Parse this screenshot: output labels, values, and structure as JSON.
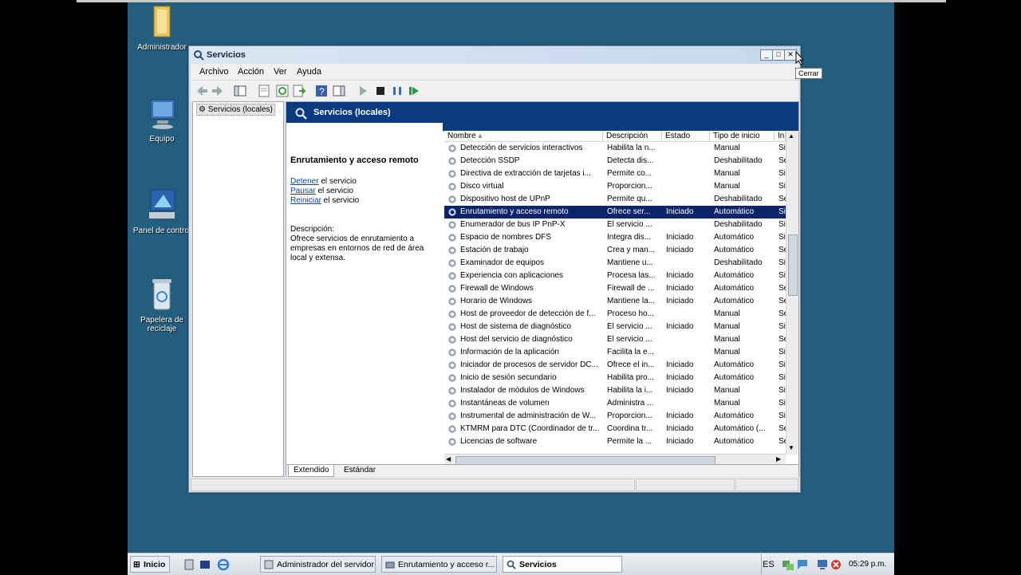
{
  "desktop": {
    "icons": [
      {
        "name": "admin-folder-icon",
        "label": "Administrador"
      },
      {
        "name": "computer-icon",
        "label": "Equipo"
      },
      {
        "name": "control-panel-icon",
        "label": "Panel de control"
      },
      {
        "name": "recycle-bin-icon",
        "label": "Papelera de reciclaje"
      }
    ]
  },
  "window": {
    "title": "Servicios",
    "tooltip": "Cerrar",
    "menu": [
      "Archivo",
      "Acción",
      "Ver",
      "Ayuda"
    ],
    "tree_node": "Servicios (locales)",
    "header_title": "Servicios (locales)",
    "extended": {
      "service_name": "Enrutamiento y acceso remoto",
      "actions": [
        {
          "link": "Detener",
          "rest": " el servicio"
        },
        {
          "link": "Pausar",
          "rest": " el servicio"
        },
        {
          "link": "Reiniciar",
          "rest": " el servicio"
        }
      ],
      "description_label": "Descripción:",
      "description_lines": [
        "Ofrece servicios de enrutamiento a",
        "empresas en entornos de red de área",
        "local y extensa."
      ]
    },
    "columns": [
      "Nombre",
      "Descripción",
      "Estado",
      "Tipo de inicio",
      "In"
    ],
    "rows": [
      {
        "name": "Detección de servicios interactivos",
        "desc": "Habilita la n...",
        "state": "",
        "start": "Manual",
        "logon": "Si"
      },
      {
        "name": "Detección SSDP",
        "desc": "Detecta dis...",
        "state": "",
        "start": "Deshabilitado",
        "logon": "Se"
      },
      {
        "name": "Directiva de extracción de tarjetas i...",
        "desc": "Permite co...",
        "state": "",
        "start": "Manual",
        "logon": "Si"
      },
      {
        "name": "Disco virtual",
        "desc": "Proporcion...",
        "state": "",
        "start": "Manual",
        "logon": "Si"
      },
      {
        "name": "Dispositivo host de UPnP",
        "desc": "Permite qu...",
        "state": "",
        "start": "Deshabilitado",
        "logon": "Se"
      },
      {
        "name": "Enrutamiento y acceso remoto",
        "desc": "Ofrece ser...",
        "state": "Iniciado",
        "start": "Automático",
        "logon": "Si",
        "selected": true
      },
      {
        "name": "Enumerador de bus IP PnP-X",
        "desc": "El servicio ...",
        "state": "",
        "start": "Deshabilitado",
        "logon": "Si"
      },
      {
        "name": "Espacio de nombres DFS",
        "desc": "Integra dis...",
        "state": "Iniciado",
        "start": "Automático",
        "logon": "Si"
      },
      {
        "name": "Estación de trabajo",
        "desc": "Crea y man...",
        "state": "Iniciado",
        "start": "Automático",
        "logon": "Se"
      },
      {
        "name": "Examinador de equipos",
        "desc": "Mantiene u...",
        "state": "",
        "start": "Deshabilitado",
        "logon": "Si"
      },
      {
        "name": "Experiencia con aplicaciones",
        "desc": "Procesa las...",
        "state": "Iniciado",
        "start": "Automático",
        "logon": "Si"
      },
      {
        "name": "Firewall de Windows",
        "desc": "Firewall de ...",
        "state": "Iniciado",
        "start": "Automático",
        "logon": "Se"
      },
      {
        "name": "Horario de Windows",
        "desc": "Mantiene la...",
        "state": "Iniciado",
        "start": "Automático",
        "logon": "Se"
      },
      {
        "name": "Host de proveedor de detección de f...",
        "desc": "Proceso ho...",
        "state": "",
        "start": "Manual",
        "logon": "Se"
      },
      {
        "name": "Host de sistema de diagnóstico",
        "desc": "El servicio ...",
        "state": "Iniciado",
        "start": "Manual",
        "logon": "Si"
      },
      {
        "name": "Host del servicio de diagnóstico",
        "desc": "El servicio ...",
        "state": "",
        "start": "Manual",
        "logon": "Se"
      },
      {
        "name": "Información de la aplicación",
        "desc": "Facilita la e...",
        "state": "",
        "start": "Manual",
        "logon": "Si"
      },
      {
        "name": "Iniciador de procesos de servidor DC...",
        "desc": "Ofrece el in...",
        "state": "Iniciado",
        "start": "Automático",
        "logon": "Si"
      },
      {
        "name": "Inicio de sesión secundario",
        "desc": "Habilita pro...",
        "state": "Iniciado",
        "start": "Automático",
        "logon": "Si"
      },
      {
        "name": "Instalador de módulos de Windows",
        "desc": "Habilita la i...",
        "state": "Iniciado",
        "start": "Manual",
        "logon": "Si"
      },
      {
        "name": "Instantáneas de volumen",
        "desc": "Administra ...",
        "state": "",
        "start": "Manual",
        "logon": "Si"
      },
      {
        "name": "Instrumental de administración de W...",
        "desc": "Proporcion...",
        "state": "Iniciado",
        "start": "Automático",
        "logon": "Si"
      },
      {
        "name": "KTMRM para DTC (Coordinador de tr...",
        "desc": "Coordina tr...",
        "state": "Iniciado",
        "start": "Automático (...",
        "logon": "Se"
      },
      {
        "name": "Licencias de software",
        "desc": "Permite la ...",
        "state": "Iniciado",
        "start": "Automático",
        "logon": "Se"
      }
    ],
    "tabs": [
      "Extendido",
      "Estándar"
    ]
  },
  "taskbar": {
    "start": "Inicio",
    "tasks": [
      "Administrador del servidor",
      "Enrutamiento y acceso r...",
      "Servicios"
    ],
    "language": "ES",
    "clock": "05:29 p.m."
  },
  "colors": {
    "desktop": "#245e7e",
    "header": "#0b3a7e",
    "selection": "#0b246a"
  }
}
